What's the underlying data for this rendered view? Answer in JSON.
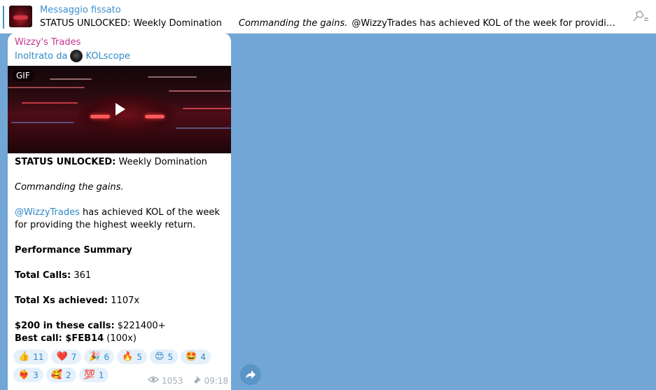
{
  "pinned": {
    "title": "Messaggio fissato",
    "text_bold": "STATUS UNLOCKED: Weekly Domination",
    "text_italic": "Commanding the gains.",
    "text_rest": "@WizzyTrades has achieved KOL of the week for providing the highe..."
  },
  "message": {
    "sender": "Wizzy's Trades",
    "forwarded_prefix": "Inoltrato da",
    "forwarded_from": "KOLscope",
    "media_badge": "GIF",
    "line1_bold": "STATUS UNLOCKED:",
    "line1_rest": " Weekly Domination",
    "line2": "Commanding the gains.",
    "mention": "@WizzyTrades",
    "line3_rest": " has achieved KOL of the week for providing the highest weekly return.",
    "summary_heading": "Performance Summary",
    "total_calls_label": "Total Calls:",
    "total_calls_value": " 361",
    "total_xs_label": "Total Xs achieved:",
    "total_xs_value": " 1107x",
    "calls200_label": "$200 in these calls:",
    "calls200_value": " $221400+",
    "best_call_label": "Best call:",
    "best_call_ticker": " $FEB14",
    "best_call_value": " (100x)",
    "views": "1053",
    "time": "09:18"
  },
  "reactions": [
    {
      "emoji": "👍",
      "count": "11"
    },
    {
      "emoji": "❤️",
      "count": "7"
    },
    {
      "emoji": "🎉",
      "count": "6"
    },
    {
      "emoji": "🔥",
      "count": "5"
    },
    {
      "emoji": "😍",
      "count": "5"
    },
    {
      "emoji": "🤩",
      "count": "4"
    },
    {
      "emoji": "❤️‍🔥",
      "count": "3"
    },
    {
      "emoji": "🥰",
      "count": "2"
    },
    {
      "emoji": "💯",
      "count": "1"
    }
  ]
}
